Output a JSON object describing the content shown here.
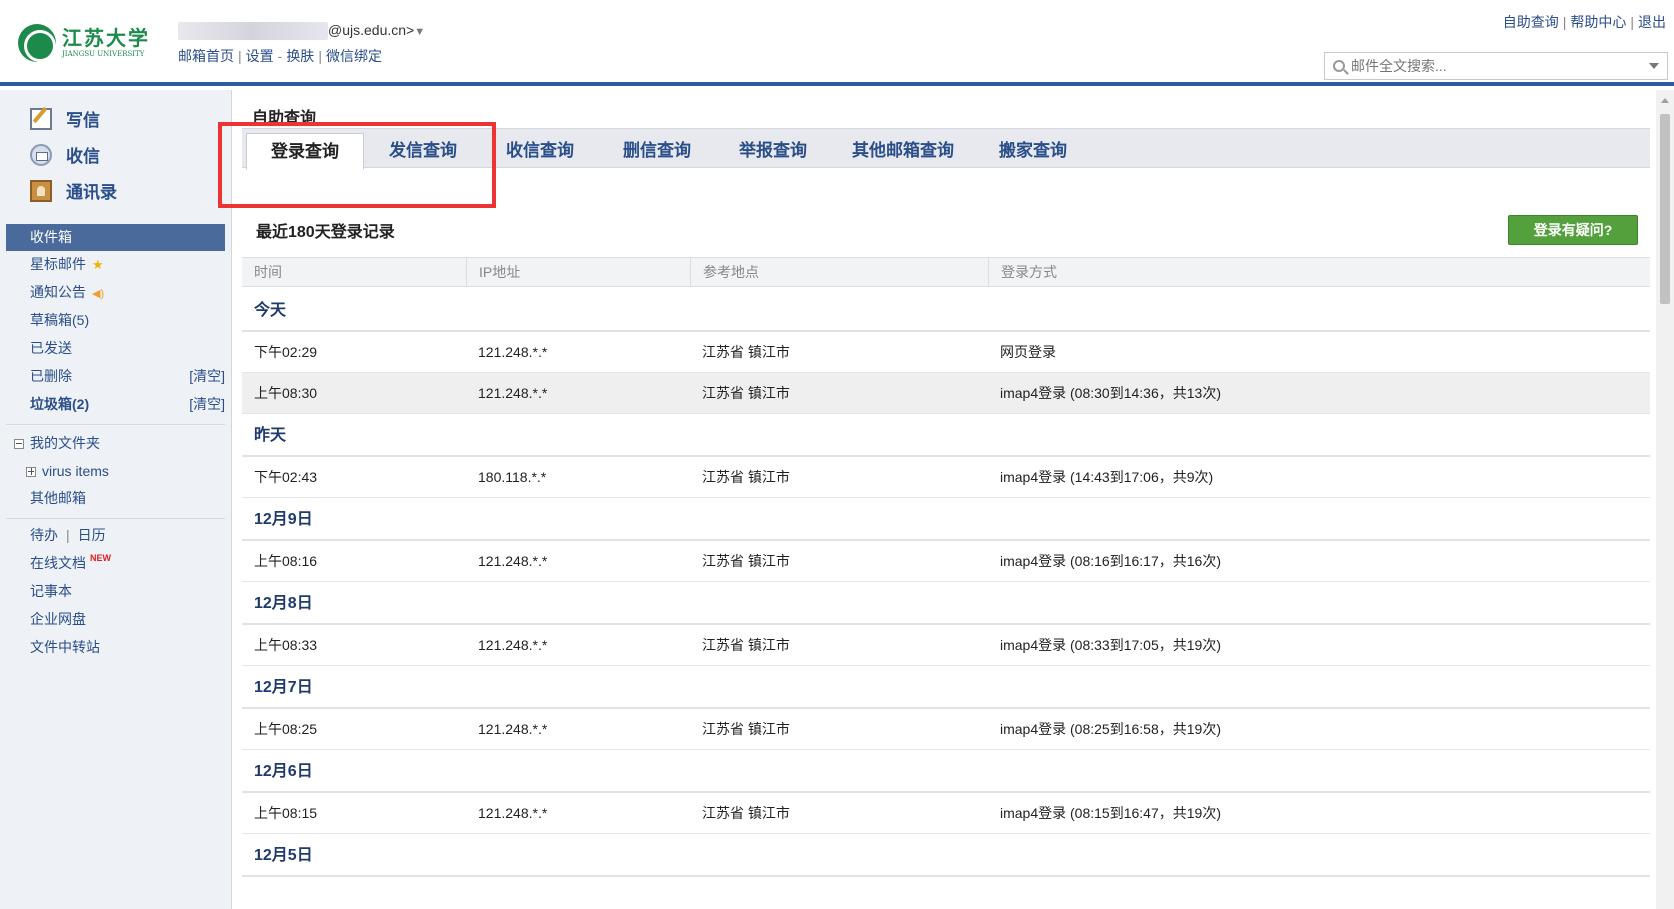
{
  "header": {
    "logo_cn": "江苏大学",
    "logo_en": "JIANGSU UNIVERSITY",
    "account_suffix": "@ujs.edu.cn>",
    "account_dropdown": "▼",
    "links": [
      "邮箱首页",
      "设置",
      "换肤",
      "微信绑定"
    ],
    "top_links": [
      "自助查询",
      "帮助中心",
      "退出"
    ],
    "search_placeholder": "邮件全文搜索..."
  },
  "sidebar": {
    "actions": [
      {
        "label": "写信",
        "icon": "compose-icon"
      },
      {
        "label": "收信",
        "icon": "receive-mail-icon"
      },
      {
        "label": "通讯录",
        "icon": "contacts-icon"
      }
    ],
    "folders": {
      "inbox": "收件箱",
      "starred": "星标邮件",
      "notice": "通知公告",
      "drafts": "草稿箱(5)",
      "sent": "已发送",
      "deleted": "已删除",
      "deleted_clear": "[清空]",
      "spam": "垃圾箱(2)",
      "spam_clear": "[清空]",
      "my_folders": "我的文件夹",
      "virus": "virus items",
      "other_mail": "其他邮箱"
    },
    "apps": {
      "todo": "待办",
      "calendar": "日历",
      "docs": "在线文档",
      "new_badge": "NEW",
      "notes": "记事本",
      "disk": "企业网盘",
      "transfer": "文件中转站"
    }
  },
  "main": {
    "page_title": "自助查询",
    "tabs": [
      "登录查询",
      "发信查询",
      "收信查询",
      "删信查询",
      "举报查询",
      "其他邮箱查询",
      "搬家查询"
    ],
    "active_tab": "登录查询",
    "section_title": "最近180天登录记录",
    "question_button": "登录有疑问?",
    "columns": [
      "时间",
      "IP地址",
      "参考地点",
      "登录方式"
    ],
    "groups": [
      {
        "label": "今天",
        "rows": [
          [
            "下午02:29",
            "121.248.*.*",
            "江苏省 镇江市",
            "网页登录"
          ],
          [
            "上午08:30",
            "121.248.*.*",
            "江苏省 镇江市",
            "imap4登录 (08:30到14:36，共13次)"
          ]
        ]
      },
      {
        "label": "昨天",
        "rows": [
          [
            "下午02:43",
            "180.118.*.*",
            "江苏省 镇江市",
            "imap4登录 (14:43到17:06，共9次)"
          ]
        ]
      },
      {
        "label": "12月9日",
        "rows": [
          [
            "上午08:16",
            "121.248.*.*",
            "江苏省 镇江市",
            "imap4登录 (08:16到16:17，共16次)"
          ]
        ]
      },
      {
        "label": "12月8日",
        "rows": [
          [
            "上午08:33",
            "121.248.*.*",
            "江苏省 镇江市",
            "imap4登录 (08:33到17:05，共19次)"
          ]
        ]
      },
      {
        "label": "12月7日",
        "rows": [
          [
            "上午08:25",
            "121.248.*.*",
            "江苏省 镇江市",
            "imap4登录 (08:25到16:58，共19次)"
          ]
        ]
      },
      {
        "label": "12月6日",
        "rows": [
          [
            "上午08:15",
            "121.248.*.*",
            "江苏省 镇江市",
            "imap4登录 (08:15到16:47，共19次)"
          ]
        ]
      },
      {
        "label": "12月5日",
        "rows": []
      }
    ]
  },
  "colors": {
    "accent": "#2c5d9a",
    "highlight": "#ee3333",
    "button_green": "#53a03c"
  }
}
